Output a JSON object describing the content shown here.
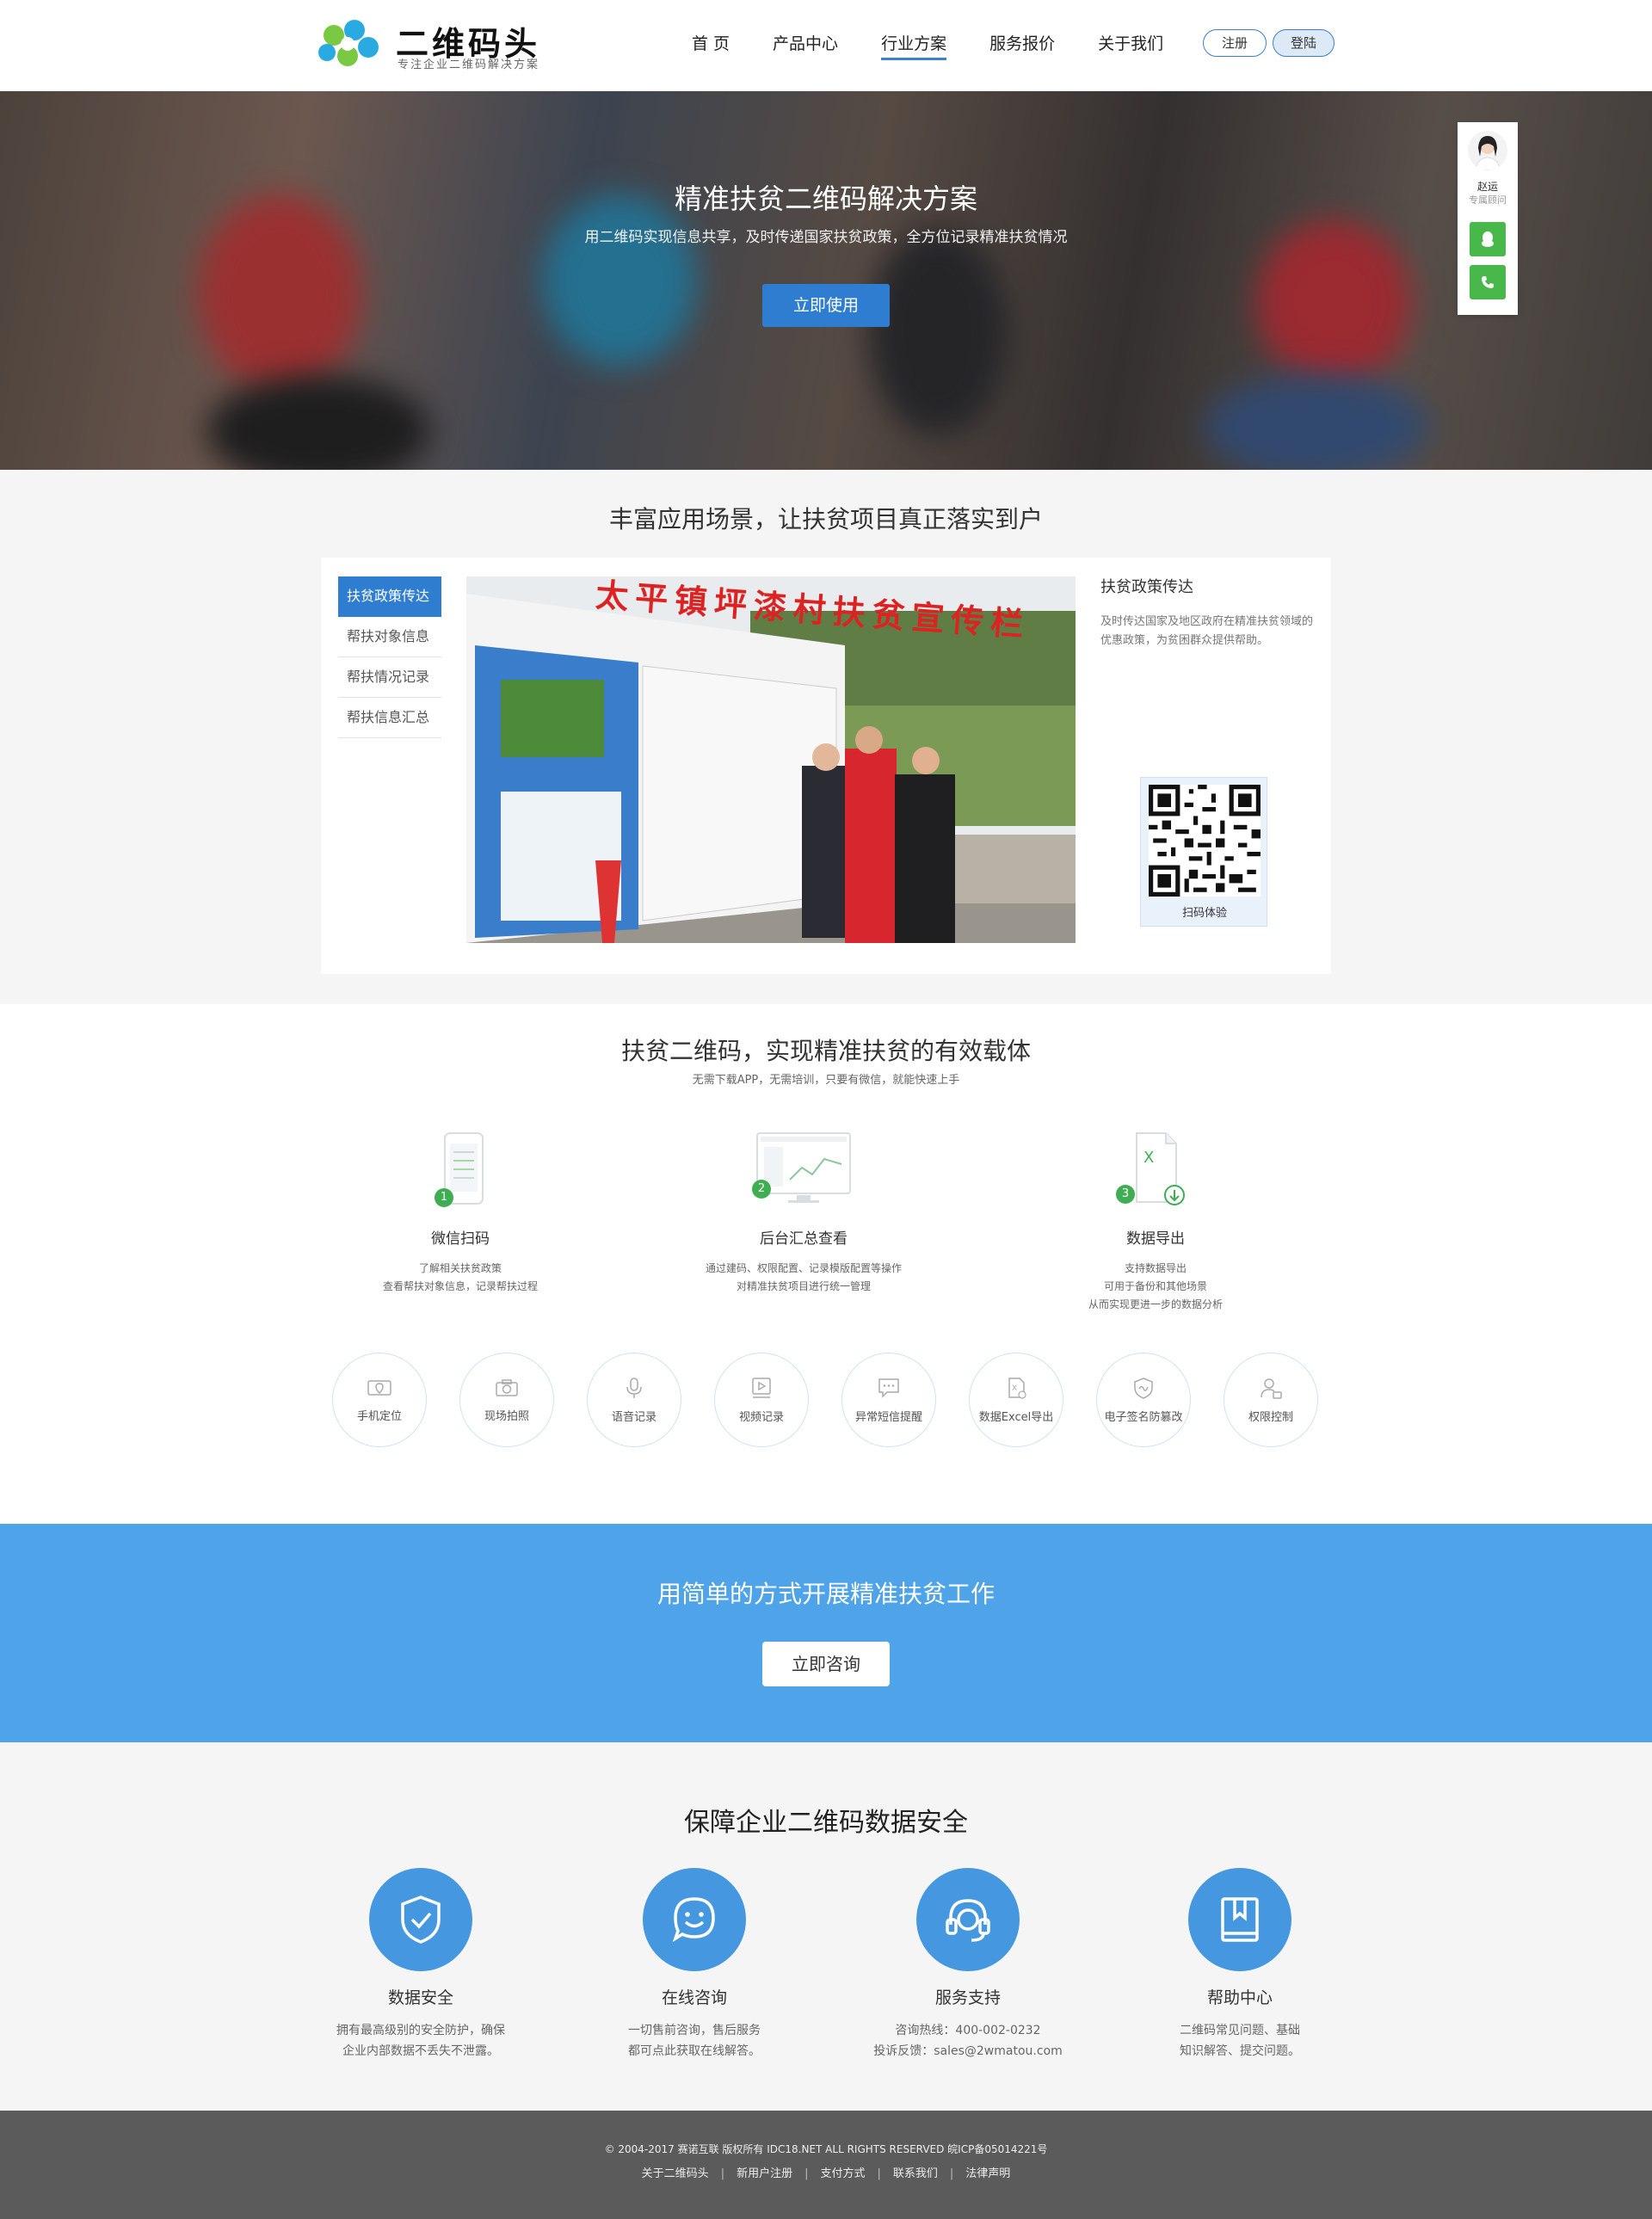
{
  "header": {
    "logo_title": "二维码头",
    "logo_sub": "专注企业二维码解决方案",
    "nav": [
      "首 页",
      "产品中心",
      "行业方案",
      "服务报价",
      "关于我们"
    ],
    "active_nav": "行业方案",
    "register": "注册",
    "login": "登陆",
    "accent_color": "#3a7fd0"
  },
  "hero": {
    "title": "精准扶贫二维码解决方案",
    "desc": "用二维码实现信息共享，及时传递国家扶贫政策，全方位记录精准扶贫情况",
    "button": "立即使用"
  },
  "consultant": {
    "name": "赵运",
    "role": "专属顾问",
    "qq_icon": "qq-icon",
    "phone_icon": "phone-icon",
    "color": "#49b84a"
  },
  "scenarios": {
    "title": "丰富应用场景，让扶贫项目真正落实到户",
    "tabs": [
      "扶贫政策传达",
      "帮扶对象信息",
      "帮扶情况记录",
      "帮扶信息汇总"
    ],
    "active_tab": "扶贫政策传达",
    "photo_sign": "太平镇坪漆村扶贫宣传栏",
    "detail_title": "扶贫政策传达",
    "detail_text": "及时传达国家及地区政府在精准扶贫领域的优惠政策，为贫困群众提供帮助。",
    "qr_caption": "扫码体验"
  },
  "carrier": {
    "title": "扶贫二维码，实现精准扶贫的有效载体",
    "subtitle": "无需下载APP，无需培训，只要有微信，就能快速上手",
    "steps": [
      {
        "num": "1",
        "name": "微信扫码",
        "desc1": "了解相关扶贫政策",
        "desc2": "查看帮扶对象信息，记录帮扶过程",
        "desc3": ""
      },
      {
        "num": "2",
        "name": "后台汇总查看",
        "desc1": "通过建码、权限配置、记录模版配置等操作",
        "desc2": "对精准扶贫项目进行统一管理",
        "desc3": ""
      },
      {
        "num": "3",
        "name": "数据导出",
        "desc1": "支持数据导出",
        "desc2": "可用于备份和其他场景",
        "desc3": "从而实现更进一步的数据分析"
      }
    ],
    "features": [
      "手机定位",
      "现场拍照",
      "语音记录",
      "视频记录",
      "异常短信提醒",
      "数据Excel导出",
      "电子签名防篡改",
      "权限控制"
    ]
  },
  "cta": {
    "title": "用简单的方式开展精准扶贫工作",
    "button": "立即咨询",
    "bg_color": "#4fa3e9"
  },
  "security": {
    "title": "保障企业二维码数据安全",
    "items": [
      {
        "name": "数据安全",
        "line1": "拥有最高级别的安全防护，确保",
        "line2": "企业内部数据不丢失不泄露。",
        "icon": "shield-check-icon"
      },
      {
        "name": "在线咨询",
        "line1": "一切售前咨询，售后服务",
        "line2": "都可点此获取在线解答。",
        "icon": "chat-smile-icon"
      },
      {
        "name": "服务支持",
        "line1": "咨询热线：400-002-0232",
        "line2": "投诉反馈：sales@2wmatou.com",
        "icon": "headset-icon"
      },
      {
        "name": "帮助中心",
        "line1": "二维码常见问题、基础",
        "line2": "知识解答、提交问题。",
        "icon": "book-icon"
      }
    ],
    "circle_color": "#4598e0"
  },
  "footer": {
    "copyright": "© 2004-2017 赛诺互联   版权所有 IDC18.NET ALL RIGHTS RESERVED   皖ICP备05014221号",
    "links": [
      "关于二维码头",
      "新用户注册",
      "支付方式",
      "联系我们",
      "法律声明"
    ]
  }
}
